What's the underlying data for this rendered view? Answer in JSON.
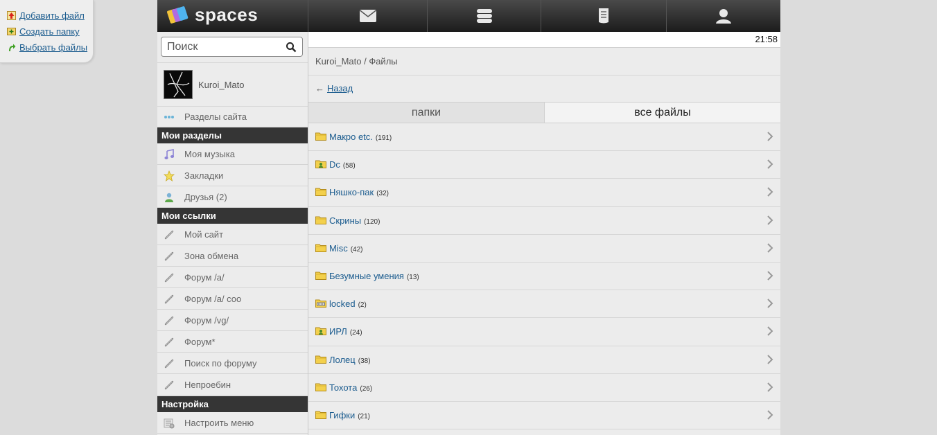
{
  "upload_panel": {
    "add_file": "Добавить файл",
    "create_folder": "Создать папку",
    "choose_files": "Выбрать файлы"
  },
  "header": {
    "brand": "spaces",
    "nav": [
      {
        "icon": "mail-icon"
      },
      {
        "icon": "chat-icon"
      },
      {
        "icon": "journal-icon"
      },
      {
        "icon": "user-icon"
      }
    ]
  },
  "sidebar": {
    "search_placeholder": "Поиск",
    "profile_name": "Kuroi_Mato",
    "site_sections": "Разделы сайта",
    "my_sections_title": "Мои разделы",
    "my_sections": [
      {
        "label": "Моя музыка",
        "icon": "music-icon"
      },
      {
        "label": "Закладки",
        "icon": "star-icon"
      },
      {
        "label": "Друзья (2)",
        "icon": "friends-icon"
      }
    ],
    "my_links_title": "Мои ссылки",
    "my_links": [
      {
        "label": "Мой сайт"
      },
      {
        "label": "Зона обмена"
      },
      {
        "label": "Форум /a/"
      },
      {
        "label": "Форум /a/ соо"
      },
      {
        "label": "Форум /vg/"
      },
      {
        "label": "Форум*"
      },
      {
        "label": "Поиск по форуму"
      },
      {
        "label": "Непроебин"
      }
    ],
    "settings_title": "Настройка",
    "settings_item": "Настроить меню"
  },
  "content": {
    "clock": "21:58",
    "breadcrumb": "Kuroi_Mato / Файлы",
    "back_arrow": "←",
    "back_label": "Назад",
    "tabs": {
      "folders": "папки",
      "all_files": "все файлы"
    },
    "folders": [
      {
        "name": "Макро etc.",
        "count": "(191)",
        "icon": "folder-icon"
      },
      {
        "name": "Dc",
        "count": "(58)",
        "icon": "shared-folder-icon"
      },
      {
        "name": "Няшко-пак",
        "count": "(32)",
        "icon": "folder-icon"
      },
      {
        "name": "Скрины",
        "count": "(120)",
        "icon": "folder-icon"
      },
      {
        "name": "Misc",
        "count": "(42)",
        "icon": "folder-icon"
      },
      {
        "name": "Безумные умения",
        "count": "(13)",
        "icon": "folder-icon"
      },
      {
        "name": "locked",
        "count": "(2)",
        "icon": "locked-folder-icon"
      },
      {
        "name": "ИРЛ",
        "count": "(24)",
        "icon": "shared-folder-icon"
      },
      {
        "name": "Лолец",
        "count": "(38)",
        "icon": "folder-icon"
      },
      {
        "name": "Тохота",
        "count": "(26)",
        "icon": "folder-icon"
      },
      {
        "name": "Гифки",
        "count": "(21)",
        "icon": "folder-icon"
      }
    ]
  },
  "colors": {
    "link": "#1a5b8e",
    "header_dark": "#1c1c1c",
    "section_head": "#353535"
  }
}
